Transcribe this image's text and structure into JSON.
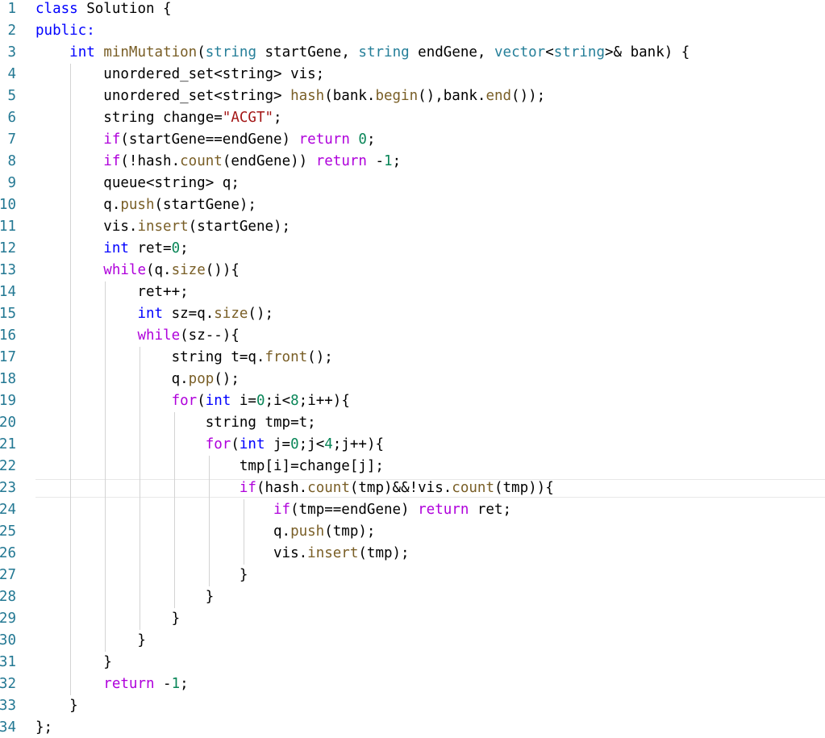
{
  "editor": {
    "language": "cpp",
    "active_line": 23,
    "colors": {
      "keyword": "#0000ff",
      "control": "#af00db",
      "type": "#267f99",
      "function": "#795e26",
      "string": "#a31515",
      "number": "#098658",
      "plain": "#000000",
      "line_number": "#237893",
      "indent_guide": "#d3d3d3",
      "active_indent_guide": "#939393"
    },
    "lines": [
      {
        "no": "1",
        "tokens": [
          {
            "t": "class",
            "c": "keyword"
          },
          {
            "t": " Solution {",
            "c": "plain"
          }
        ]
      },
      {
        "no": "2",
        "tokens": [
          {
            "t": "public:",
            "c": "keyword"
          }
        ]
      },
      {
        "no": "3",
        "tokens": [
          {
            "t": "    ",
            "c": "plain"
          },
          {
            "t": "int",
            "c": "keyword"
          },
          {
            "t": " ",
            "c": "plain"
          },
          {
            "t": "minMutation",
            "c": "function"
          },
          {
            "t": "(",
            "c": "plain"
          },
          {
            "t": "string",
            "c": "type"
          },
          {
            "t": " startGene, ",
            "c": "plain"
          },
          {
            "t": "string",
            "c": "type"
          },
          {
            "t": " endGene, ",
            "c": "plain"
          },
          {
            "t": "vector",
            "c": "type"
          },
          {
            "t": "<",
            "c": "plain"
          },
          {
            "t": "string",
            "c": "type"
          },
          {
            "t": ">& bank) {",
            "c": "plain"
          }
        ]
      },
      {
        "no": "4",
        "tokens": [
          {
            "t": "        unordered_set<string> vis;",
            "c": "plain"
          }
        ]
      },
      {
        "no": "5",
        "tokens": [
          {
            "t": "        unordered_set<string> ",
            "c": "plain"
          },
          {
            "t": "hash",
            "c": "function"
          },
          {
            "t": "(bank.",
            "c": "plain"
          },
          {
            "t": "begin",
            "c": "function"
          },
          {
            "t": "(),bank.",
            "c": "plain"
          },
          {
            "t": "end",
            "c": "function"
          },
          {
            "t": "());",
            "c": "plain"
          }
        ]
      },
      {
        "no": "6",
        "tokens": [
          {
            "t": "        string change=",
            "c": "plain"
          },
          {
            "t": "\"ACGT\"",
            "c": "string"
          },
          {
            "t": ";",
            "c": "plain"
          }
        ]
      },
      {
        "no": "7",
        "tokens": [
          {
            "t": "        ",
            "c": "plain"
          },
          {
            "t": "if",
            "c": "control"
          },
          {
            "t": "(startGene==endGene) ",
            "c": "plain"
          },
          {
            "t": "return",
            "c": "control"
          },
          {
            "t": " ",
            "c": "plain"
          },
          {
            "t": "0",
            "c": "number"
          },
          {
            "t": ";",
            "c": "plain"
          }
        ]
      },
      {
        "no": "8",
        "tokens": [
          {
            "t": "        ",
            "c": "plain"
          },
          {
            "t": "if",
            "c": "control"
          },
          {
            "t": "(!hash.",
            "c": "plain"
          },
          {
            "t": "count",
            "c": "function"
          },
          {
            "t": "(endGene)) ",
            "c": "plain"
          },
          {
            "t": "return",
            "c": "control"
          },
          {
            "t": " -",
            "c": "plain"
          },
          {
            "t": "1",
            "c": "number"
          },
          {
            "t": ";",
            "c": "plain"
          }
        ]
      },
      {
        "no": "9",
        "tokens": [
          {
            "t": "        queue<string> q;",
            "c": "plain"
          }
        ]
      },
      {
        "no": "10",
        "tokens": [
          {
            "t": "        q.",
            "c": "plain"
          },
          {
            "t": "push",
            "c": "function"
          },
          {
            "t": "(startGene);",
            "c": "plain"
          }
        ]
      },
      {
        "no": "11",
        "tokens": [
          {
            "t": "        vis.",
            "c": "plain"
          },
          {
            "t": "insert",
            "c": "function"
          },
          {
            "t": "(startGene);",
            "c": "plain"
          }
        ]
      },
      {
        "no": "12",
        "tokens": [
          {
            "t": "        ",
            "c": "plain"
          },
          {
            "t": "int",
            "c": "keyword"
          },
          {
            "t": " ret=",
            "c": "plain"
          },
          {
            "t": "0",
            "c": "number"
          },
          {
            "t": ";",
            "c": "plain"
          }
        ]
      },
      {
        "no": "13",
        "tokens": [
          {
            "t": "        ",
            "c": "plain"
          },
          {
            "t": "while",
            "c": "control"
          },
          {
            "t": "(q.",
            "c": "plain"
          },
          {
            "t": "size",
            "c": "function"
          },
          {
            "t": "()){",
            "c": "plain"
          }
        ]
      },
      {
        "no": "14",
        "tokens": [
          {
            "t": "            ret++;",
            "c": "plain"
          }
        ]
      },
      {
        "no": "15",
        "tokens": [
          {
            "t": "            ",
            "c": "plain"
          },
          {
            "t": "int",
            "c": "keyword"
          },
          {
            "t": " sz=q.",
            "c": "plain"
          },
          {
            "t": "size",
            "c": "function"
          },
          {
            "t": "();",
            "c": "plain"
          }
        ]
      },
      {
        "no": "16",
        "tokens": [
          {
            "t": "            ",
            "c": "plain"
          },
          {
            "t": "while",
            "c": "control"
          },
          {
            "t": "(sz--){",
            "c": "plain"
          }
        ]
      },
      {
        "no": "17",
        "tokens": [
          {
            "t": "                string t=q.",
            "c": "plain"
          },
          {
            "t": "front",
            "c": "function"
          },
          {
            "t": "();",
            "c": "plain"
          }
        ]
      },
      {
        "no": "18",
        "tokens": [
          {
            "t": "                q.",
            "c": "plain"
          },
          {
            "t": "pop",
            "c": "function"
          },
          {
            "t": "();",
            "c": "plain"
          }
        ]
      },
      {
        "no": "19",
        "tokens": [
          {
            "t": "                ",
            "c": "plain"
          },
          {
            "t": "for",
            "c": "control"
          },
          {
            "t": "(",
            "c": "plain"
          },
          {
            "t": "int",
            "c": "keyword"
          },
          {
            "t": " i=",
            "c": "plain"
          },
          {
            "t": "0",
            "c": "number"
          },
          {
            "t": ";i<",
            "c": "plain"
          },
          {
            "t": "8",
            "c": "number"
          },
          {
            "t": ";i++){",
            "c": "plain"
          }
        ]
      },
      {
        "no": "20",
        "tokens": [
          {
            "t": "                    string tmp=t;",
            "c": "plain"
          }
        ]
      },
      {
        "no": "21",
        "tokens": [
          {
            "t": "                    ",
            "c": "plain"
          },
          {
            "t": "for",
            "c": "control"
          },
          {
            "t": "(",
            "c": "plain"
          },
          {
            "t": "int",
            "c": "keyword"
          },
          {
            "t": " j=",
            "c": "plain"
          },
          {
            "t": "0",
            "c": "number"
          },
          {
            "t": ";j<",
            "c": "plain"
          },
          {
            "t": "4",
            "c": "number"
          },
          {
            "t": ";j++){",
            "c": "plain"
          }
        ]
      },
      {
        "no": "22",
        "tokens": [
          {
            "t": "                        tmp[i]=change[j];",
            "c": "plain"
          }
        ]
      },
      {
        "no": "23",
        "tokens": [
          {
            "t": "                        ",
            "c": "plain"
          },
          {
            "t": "if",
            "c": "control"
          },
          {
            "t": "(hash.",
            "c": "plain"
          },
          {
            "t": "count",
            "c": "function"
          },
          {
            "t": "(tmp)&&!vis.",
            "c": "plain"
          },
          {
            "t": "count",
            "c": "function"
          },
          {
            "t": "(tmp)){",
            "c": "plain"
          }
        ]
      },
      {
        "no": "24",
        "tokens": [
          {
            "t": "                            ",
            "c": "plain"
          },
          {
            "t": "if",
            "c": "control"
          },
          {
            "t": "(tmp==endGene) ",
            "c": "plain"
          },
          {
            "t": "return",
            "c": "control"
          },
          {
            "t": " ret;",
            "c": "plain"
          }
        ]
      },
      {
        "no": "25",
        "tokens": [
          {
            "t": "                            q.",
            "c": "plain"
          },
          {
            "t": "push",
            "c": "function"
          },
          {
            "t": "(tmp);",
            "c": "plain"
          }
        ]
      },
      {
        "no": "26",
        "tokens": [
          {
            "t": "                            vis.",
            "c": "plain"
          },
          {
            "t": "insert",
            "c": "function"
          },
          {
            "t": "(tmp);",
            "c": "plain"
          }
        ]
      },
      {
        "no": "27",
        "tokens": [
          {
            "t": "                        }",
            "c": "plain"
          }
        ]
      },
      {
        "no": "28",
        "tokens": [
          {
            "t": "                    }",
            "c": "plain"
          }
        ]
      },
      {
        "no": "29",
        "tokens": [
          {
            "t": "                }",
            "c": "plain"
          }
        ]
      },
      {
        "no": "30",
        "tokens": [
          {
            "t": "            }",
            "c": "plain"
          }
        ]
      },
      {
        "no": "31",
        "tokens": [
          {
            "t": "        }",
            "c": "plain"
          }
        ]
      },
      {
        "no": "32",
        "tokens": [
          {
            "t": "        ",
            "c": "plain"
          },
          {
            "t": "return",
            "c": "control"
          },
          {
            "t": " -",
            "c": "plain"
          },
          {
            "t": "1",
            "c": "number"
          },
          {
            "t": ";",
            "c": "plain"
          }
        ]
      },
      {
        "no": "33",
        "tokens": [
          {
            "t": "    }",
            "c": "plain"
          }
        ]
      },
      {
        "no": "34",
        "tokens": [
          {
            "t": "};",
            "c": "plain"
          }
        ]
      }
    ]
  }
}
